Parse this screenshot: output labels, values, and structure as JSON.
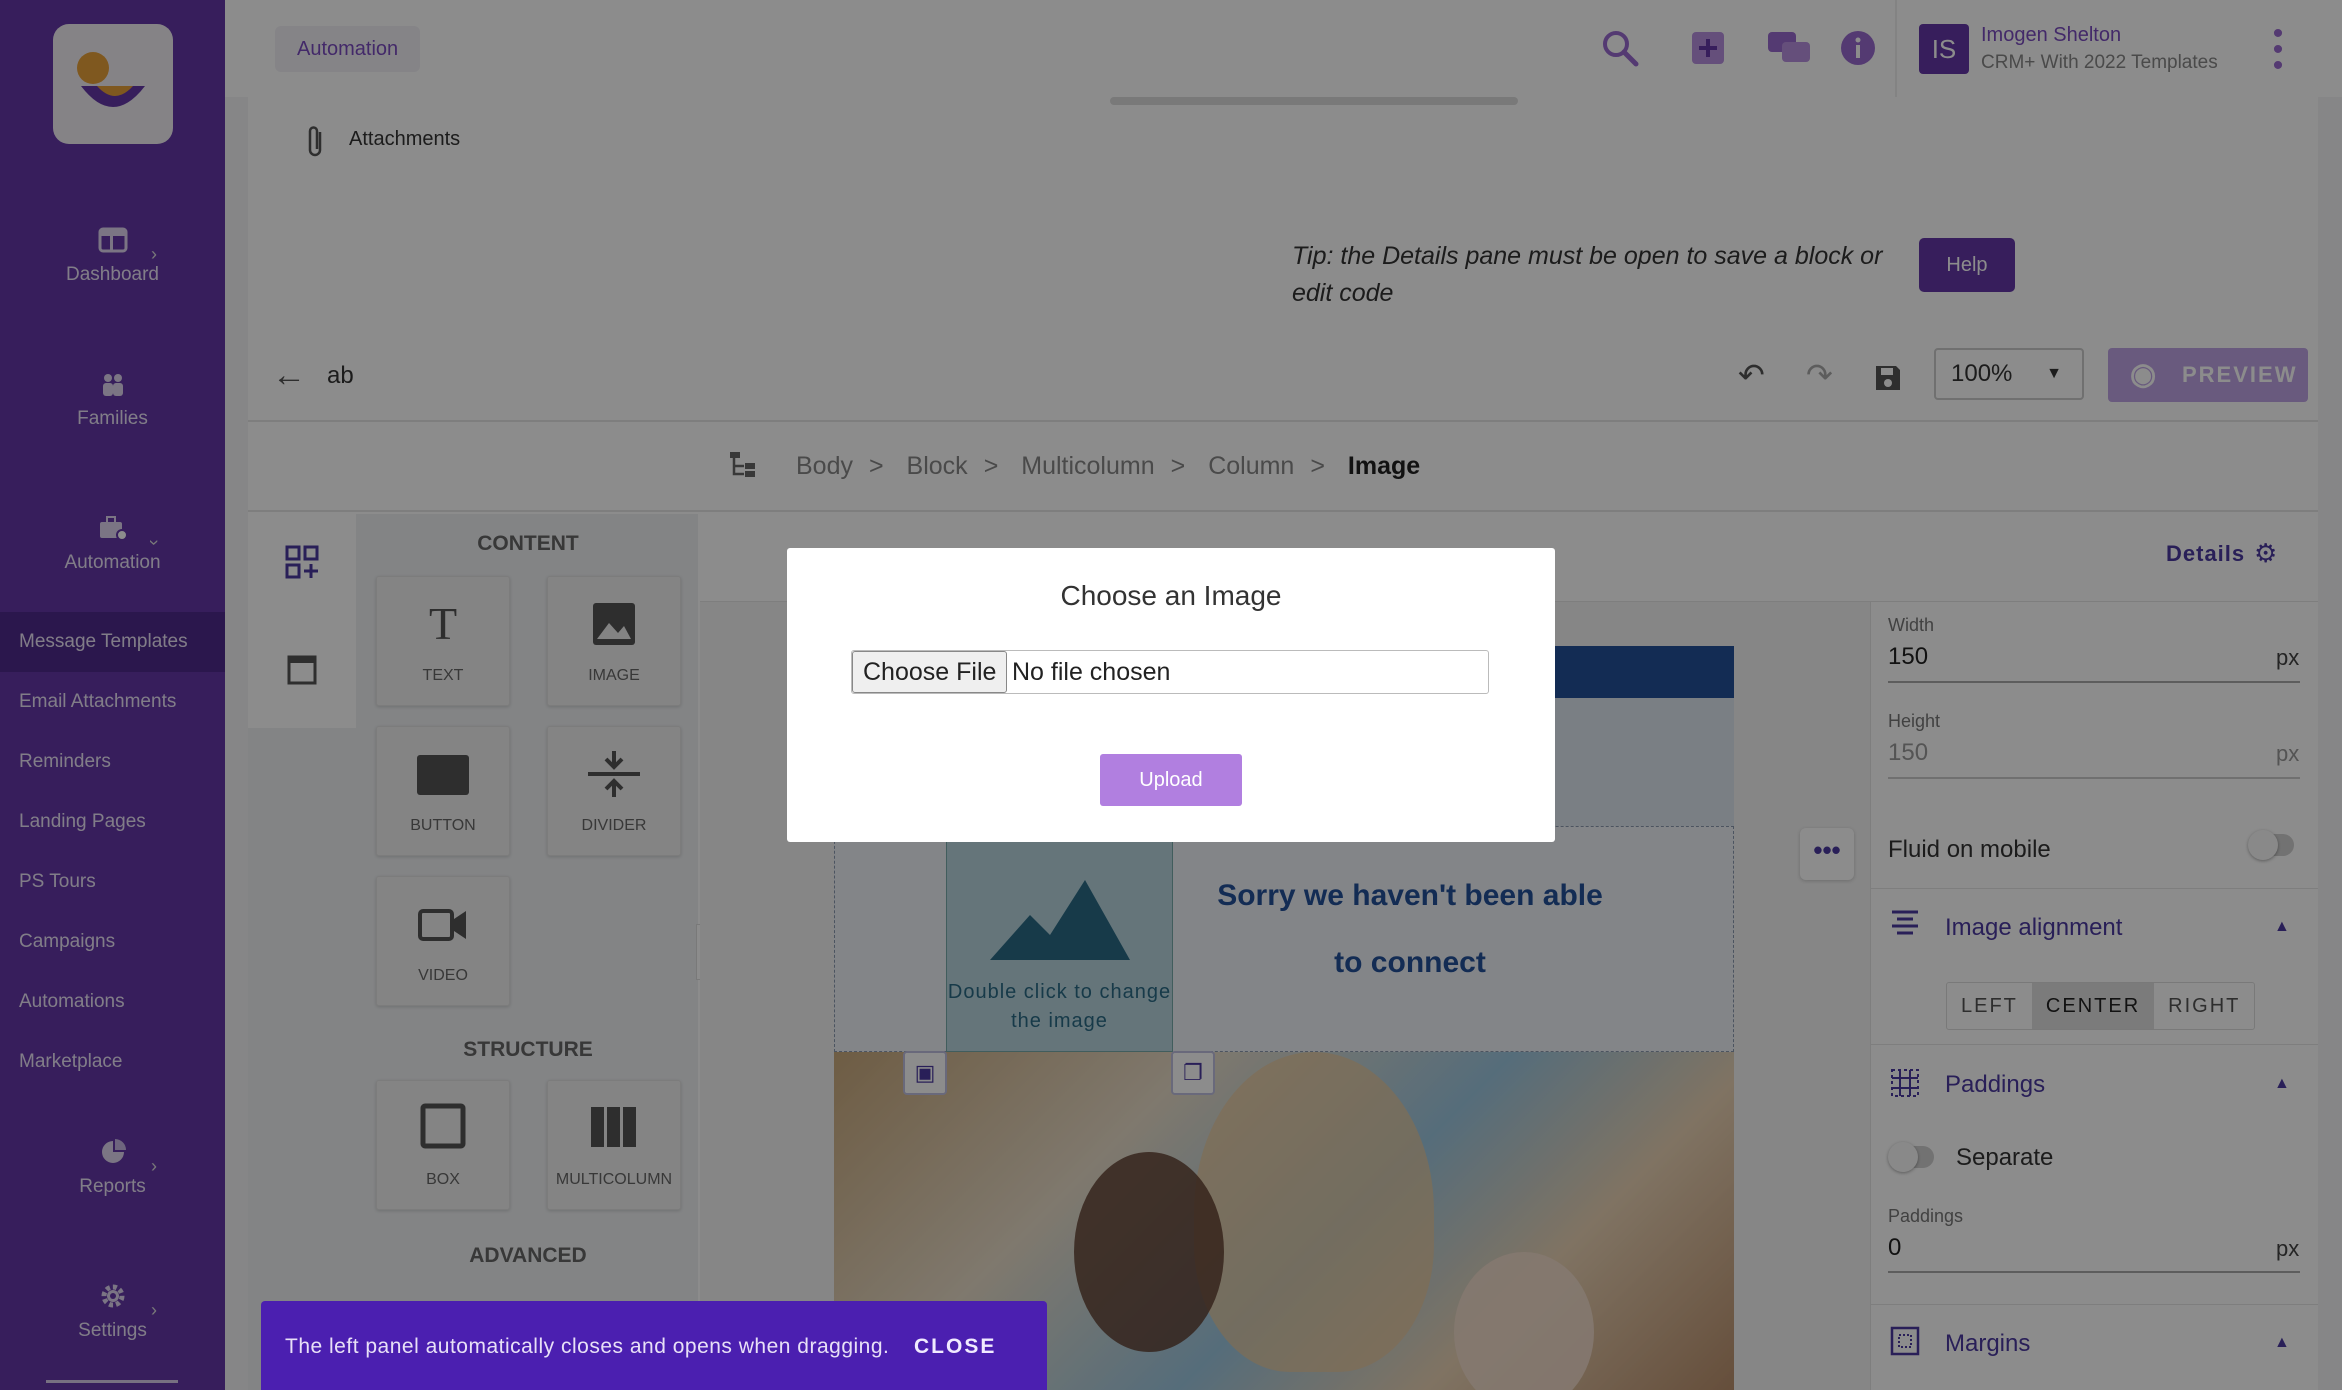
{
  "sidebar": {
    "items": [
      {
        "label": "Dashboard",
        "icon": "dashboard-icon"
      },
      {
        "label": "Families",
        "icon": "people-icon"
      },
      {
        "label": "Automation",
        "icon": "briefcase-gear-icon"
      }
    ],
    "links": [
      "Message Templates",
      "Email Attachments",
      "Reminders",
      "Landing Pages",
      "PS Tours",
      "Campaigns",
      "Automations",
      "Marketplace"
    ],
    "active_link": "Message Templates",
    "bottom_items": [
      {
        "label": "Reports",
        "icon": "pie-chart-icon"
      },
      {
        "label": "Settings",
        "icon": "gear-icon"
      }
    ]
  },
  "topbar": {
    "breadcrumb": "Automation",
    "user": {
      "initials": "IS",
      "name": "Imogen Shelton",
      "subtitle": "CRM+ With 2022 Templates"
    }
  },
  "page": {
    "attachments_label": "Attachments",
    "tip": "Tip: the Details pane must be open to save a block or edit code",
    "help_label": "Help"
  },
  "editor": {
    "doc_name": "ab",
    "zoom": "100%",
    "preview_label": "PREVIEW",
    "path": [
      "Body",
      "Block",
      "Multicolumn",
      "Column",
      "Image"
    ]
  },
  "blocks": {
    "content_title": "CONTENT",
    "content": [
      "TEXT",
      "IMAGE",
      "BUTTON",
      "DIVIDER",
      "VIDEO"
    ],
    "structure_title": "STRUCTURE",
    "structure": [
      "BOX",
      "MULTICOLUMN"
    ],
    "advanced_title": "ADVANCED"
  },
  "canvas": {
    "image_placeholder_text": "Double click to change the image",
    "heading_text": "Sorry we haven't been able to connect"
  },
  "details": {
    "title": "Details",
    "width_label": "Width",
    "width_value": "150",
    "width_unit": "px",
    "height_label": "Height",
    "height_value": "150",
    "height_unit": "px",
    "fluid_label": "Fluid on mobile",
    "image_alignment_title": "Image alignment",
    "alignment_options": [
      "LEFT",
      "CENTER",
      "RIGHT"
    ],
    "alignment_selected": "CENTER",
    "paddings_title": "Paddings",
    "separate_label": "Separate",
    "paddings_label": "Paddings",
    "paddings_value": "0",
    "paddings_unit": "px",
    "margins_title": "Margins"
  },
  "modal": {
    "title": "Choose an Image",
    "choose_file_label": "Choose File",
    "no_file_text": "No file chosen",
    "upload_label": "Upload"
  },
  "snackbar": {
    "message": "The left panel automatically closes and opens when dragging.",
    "close_label": "CLOSE"
  },
  "colors": {
    "brand": "#6438a8",
    "accent": "#4b3aa0",
    "email_blue": "#24509a"
  }
}
